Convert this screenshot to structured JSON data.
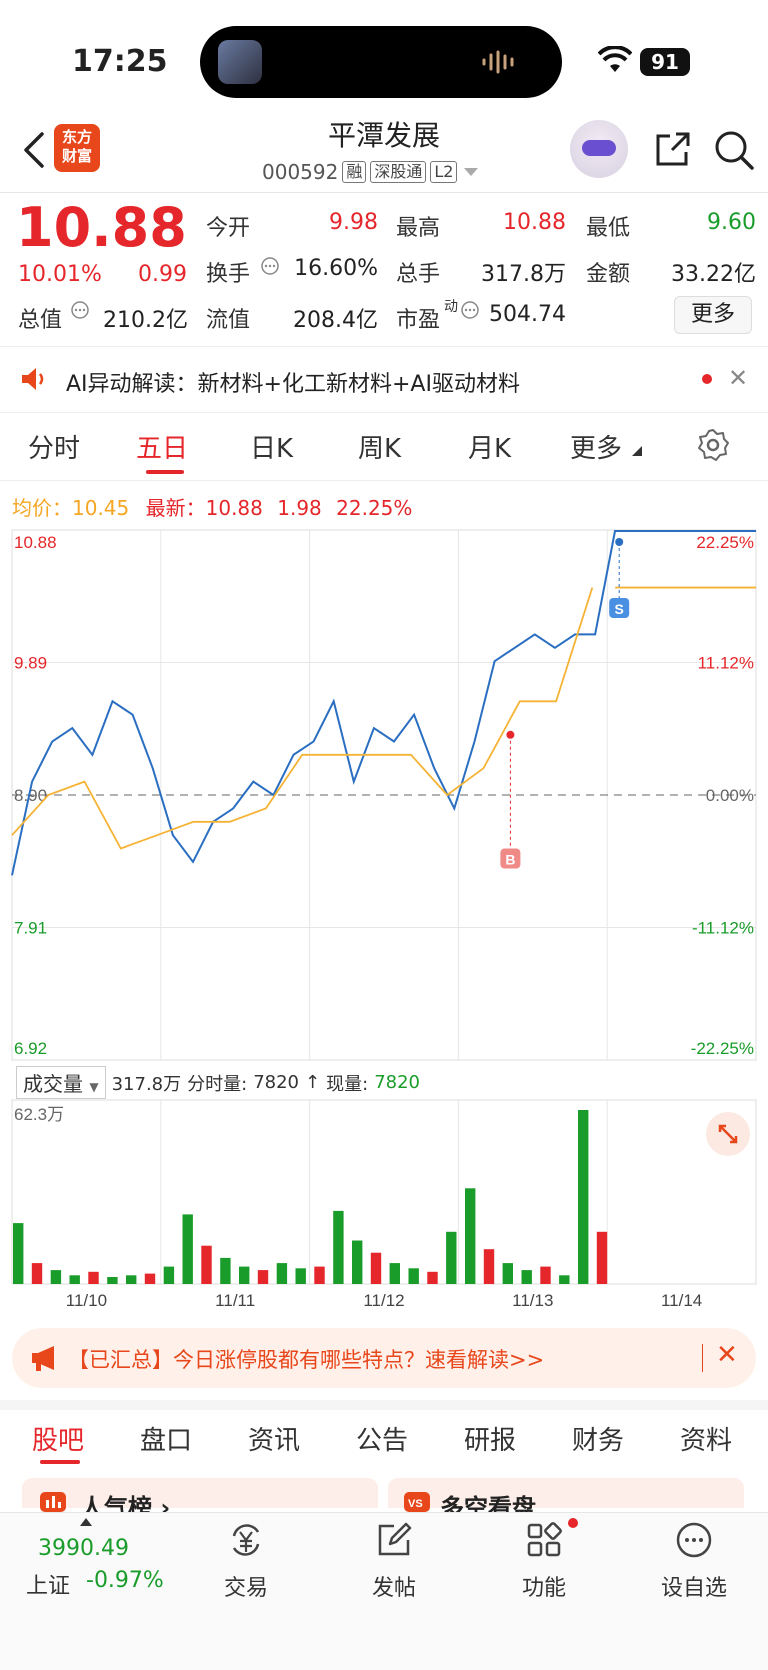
{
  "status_bar": {
    "time": "17:25",
    "battery": "91"
  },
  "header": {
    "back_icon": "chevron-left-icon",
    "logo_text": "东方\n财富",
    "stock_name": "平潭发展",
    "stock_code": "000592",
    "tags": [
      "融",
      "深股通",
      "L2"
    ],
    "share_icon": "share-icon",
    "search_icon": "search-icon"
  },
  "quote": {
    "price": "10.88",
    "pct": "10.01%",
    "change": "0.99",
    "fields": [
      {
        "label": "今开",
        "value": "9.98",
        "color": "red"
      },
      {
        "label": "最高",
        "value": "10.88",
        "color": "red"
      },
      {
        "label": "最低",
        "value": "9.60",
        "color": "green"
      },
      {
        "label": "换手",
        "value": "16.60%",
        "color": "plain"
      },
      {
        "label": "总手",
        "value": "317.8万",
        "color": "plain"
      },
      {
        "label": "金额",
        "value": "33.22亿",
        "color": "plain"
      },
      {
        "label": "总值",
        "value": "210.2亿",
        "color": "plain"
      },
      {
        "label": "流值",
        "value": "208.4亿",
        "color": "plain"
      },
      {
        "label": "市盈",
        "value": "504.74",
        "color": "plain"
      }
    ],
    "pe_superscript": "动",
    "more_label": "更多"
  },
  "ai_bar": {
    "text": "AI异动解读：新材料+化工新材料+AI驱动材料"
  },
  "kline_tabs": [
    "分时",
    "五日",
    "日K",
    "周K",
    "月K",
    "更多"
  ],
  "legend": {
    "avg_label": "均价：",
    "avg_value": "10.45",
    "latest_label": "最新：",
    "latest_value": "10.88",
    "latest_change": "1.98",
    "latest_pct": "22.25%"
  },
  "chart_data": {
    "type": "line",
    "x_labels": [
      "11/10",
      "11/11",
      "11/12",
      "11/13",
      "11/14"
    ],
    "y_left_ticks": [
      "10.88",
      "9.89",
      "8.90",
      "7.91",
      "6.92"
    ],
    "y_right_ticks": [
      "22.25%",
      "11.12%",
      "0.00%",
      "-11.12%",
      "-22.25%"
    ],
    "baseline": 8.9,
    "ylim": [
      6.92,
      10.88
    ],
    "series": [
      {
        "name": "最新",
        "color": "#2a6ec2",
        "values": [
          8.3,
          9.0,
          9.3,
          9.4,
          9.2,
          9.6,
          9.5,
          9.1,
          8.6,
          8.4,
          8.7,
          8.8,
          9.0,
          8.9,
          9.2,
          9.3,
          9.6,
          9.0,
          9.4,
          9.3,
          9.5,
          9.1,
          8.8,
          9.3,
          9.9,
          10.0,
          10.1,
          10.0,
          10.1,
          10.1,
          10.88
        ]
      },
      {
        "name": "均价",
        "color": "#f5b335",
        "values": [
          8.6,
          8.9,
          9.0,
          8.5,
          8.6,
          8.7,
          8.7,
          8.8,
          9.2,
          9.2,
          9.2,
          9.2,
          8.9,
          9.1,
          9.6,
          9.6,
          10.45
        ]
      }
    ],
    "markers": [
      {
        "label": "B",
        "day": "11/13"
      },
      {
        "label": "S",
        "day": "11/14"
      }
    ]
  },
  "volume": {
    "selector_label": "成交量",
    "total": "317.8万",
    "fenshi_label": "分时量:",
    "fenshi_value": "7820",
    "current_label": "现量:",
    "current_value": "7820",
    "max_label": "62.3万",
    "bars": [
      0.35,
      0.12,
      0.08,
      0.05,
      0.07,
      0.04,
      0.05,
      0.06,
      0.1,
      0.4,
      0.22,
      0.15,
      0.1,
      0.08,
      0.12,
      0.09,
      0.1,
      0.42,
      0.25,
      0.18,
      0.12,
      0.09,
      0.07,
      0.3,
      0.55,
      0.2,
      0.12,
      0.08,
      0.1,
      0.05,
      1.0,
      0.3
    ]
  },
  "promo": {
    "text": "【已汇总】今日涨停股都有哪些特点？速看解读>>"
  },
  "bottom_tabs": [
    "股吧",
    "盘口",
    "资讯",
    "公告",
    "研报",
    "财务",
    "资料"
  ],
  "peek_cards": [
    "人气榜 ›",
    "多空看盘"
  ],
  "bottom_nav": {
    "index_value": "3990.49",
    "index_label": "上证",
    "index_change": "-0.97%",
    "items": [
      {
        "label": "交易",
        "icon": "yuan-exchange-icon"
      },
      {
        "label": "发帖",
        "icon": "edit-icon"
      },
      {
        "label": "功能",
        "icon": "grid-icon"
      },
      {
        "label": "设自选",
        "icon": "more-dots-icon"
      }
    ]
  }
}
